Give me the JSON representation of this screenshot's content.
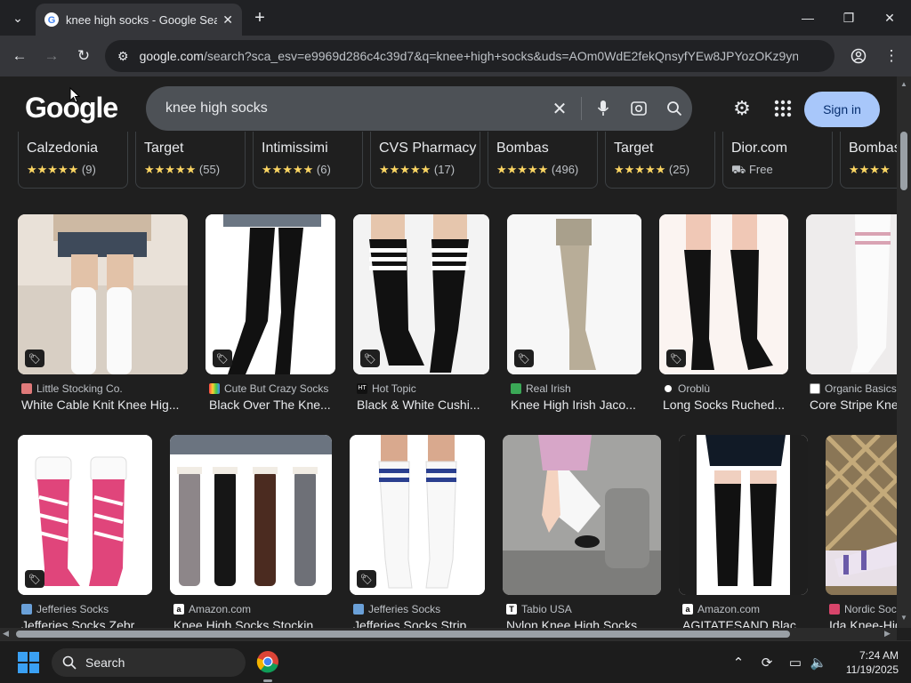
{
  "browser": {
    "tab_title": "knee high socks - Google Search",
    "url_host": "google.com",
    "url_rest": "/search?sca_esv=e9969d286c4c39d7&q=knee+high+socks&uds=AOm0WdE2fekQnsyfYEw8JPYozOKz9yn..."
  },
  "search": {
    "logo": "Google",
    "query": "knee high socks",
    "sign_in_label": "Sign in"
  },
  "merchants": [
    {
      "name": "Calzedonia",
      "stars": "★★★★★",
      "count": "(9)"
    },
    {
      "name": "Target",
      "stars": "★★★★★",
      "count": "(55)"
    },
    {
      "name": "Intimissimi",
      "stars": "★★★★★",
      "count": "(6)"
    },
    {
      "name": "CVS Pharmacy",
      "stars": "★★★★★",
      "count": "(17)"
    },
    {
      "name": "Bombas",
      "stars": "★★★★★",
      "count": "(496)"
    },
    {
      "name": "Target",
      "stars": "★★★★★",
      "count": "(25)"
    },
    {
      "name": "Dior.com",
      "stars": "",
      "count": "Free"
    },
    {
      "name": "Bombas",
      "stars": "★★★★",
      "count": ""
    }
  ],
  "row1": [
    {
      "source": "Little Stocking Co.",
      "title": "White Cable Knit Knee Hig..."
    },
    {
      "source": "Cute But Crazy Socks",
      "title": "Black Over The Kne..."
    },
    {
      "source": "Hot Topic",
      "title": "Black & White Cushi..."
    },
    {
      "source": "Real Irish",
      "title": "Knee High Irish Jaco..."
    },
    {
      "source": "Oroblù",
      "title": "Long Socks Ruched..."
    },
    {
      "source": "Organic Basics",
      "title": "Core Stripe Kne"
    }
  ],
  "row2": [
    {
      "source": "Jefferies Socks",
      "title": "Jefferies Socks Zebr..."
    },
    {
      "source": "Amazon.com",
      "title": "Knee High Socks Stockin..."
    },
    {
      "source": "Jefferies Socks",
      "title": "Jefferies Socks Strip..."
    },
    {
      "source": "Tabio USA",
      "title": "Nylon Knee High Socks"
    },
    {
      "source": "Amazon.com",
      "title": "AGITATESAND Blac..."
    },
    {
      "source": "Nordic Soc",
      "title": "Ida Knee-Hig"
    }
  ],
  "taskbar": {
    "search_label": "Search",
    "time": "7:24 AM",
    "date": "11/19/2025"
  },
  "colors": {
    "accent_signin": "#a8c7fa",
    "star": "#fdd663",
    "page_bg": "#1f1f1f"
  }
}
